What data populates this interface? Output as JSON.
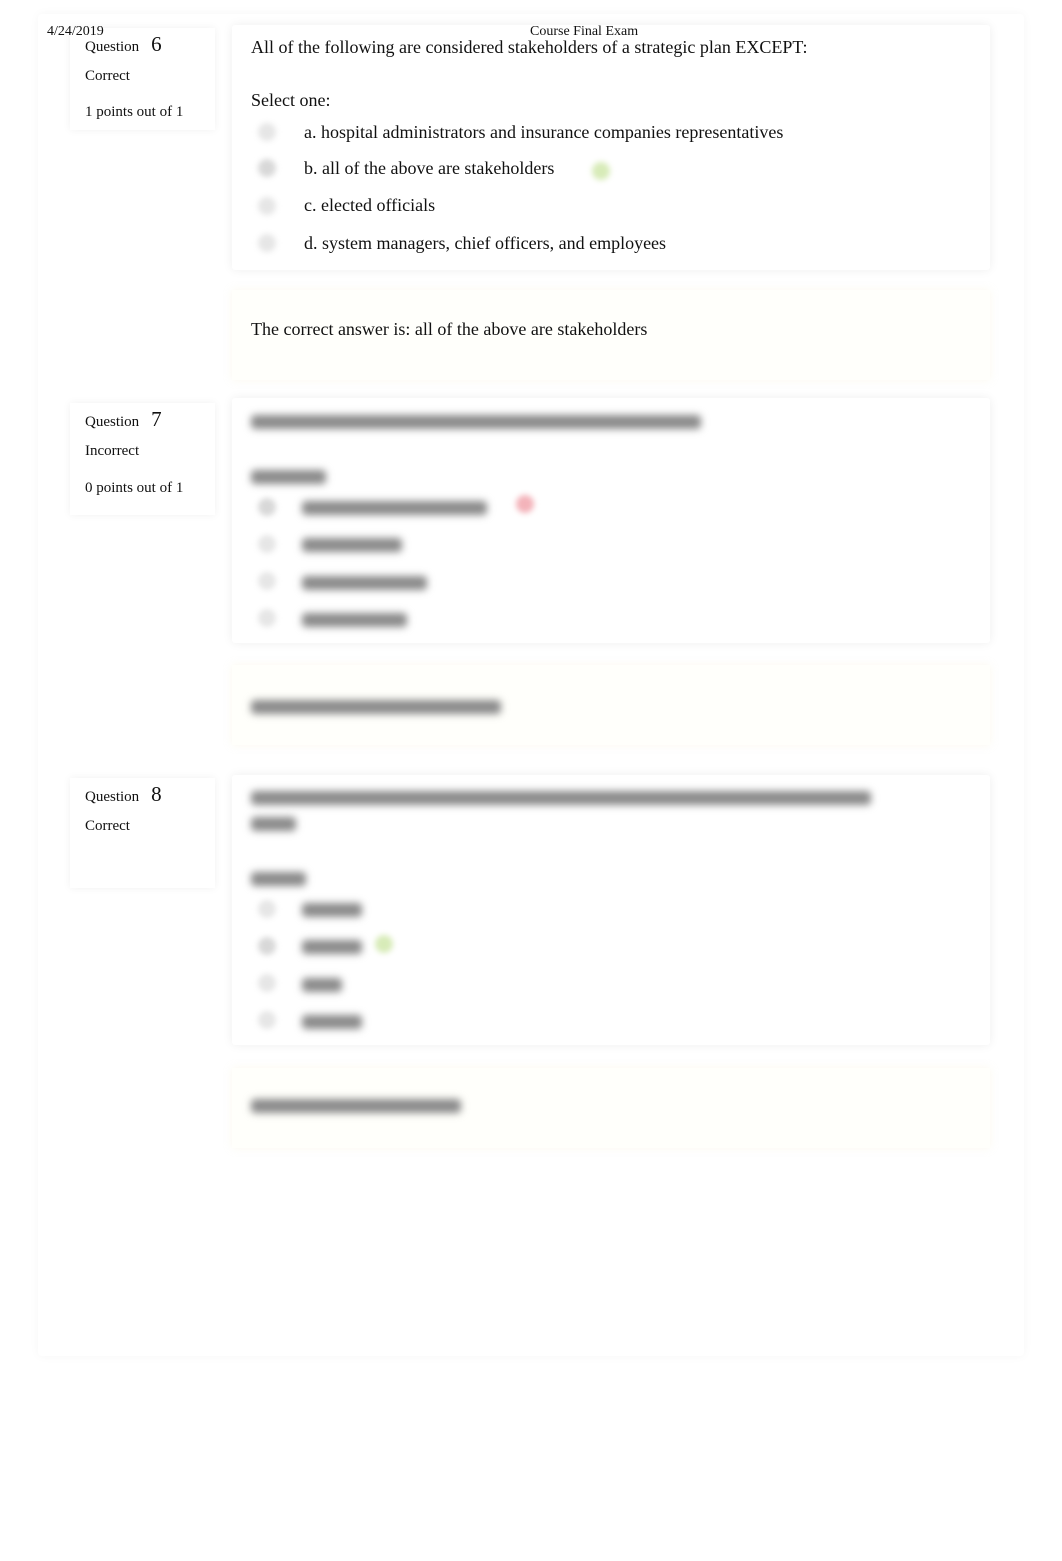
{
  "header": {
    "date": "4/24/2019",
    "title": "Course Final Exam"
  },
  "colors": {
    "correct_mark": "#c8e6a0",
    "incorrect_mark": "#f0a0a8"
  },
  "questions": [
    {
      "label": "Question",
      "number": "6",
      "status": "Correct",
      "points": "1 points out of 1",
      "text": "All of the following are considered stakeholders of a strategic plan EXCEPT:",
      "select": "Select one:",
      "options": [
        "a. hospital administrators and insurance companies representatives",
        "b. all of the above are stakeholders",
        "c. elected officials",
        "d. system managers, chief officers, and employees"
      ],
      "selected_index": 1,
      "mark": "check-icon",
      "feedback": "The correct answer is: all of the above are stakeholders"
    },
    {
      "label": "Question",
      "number": "7",
      "status": "Incorrect",
      "points": "0 points out of 1",
      "selected_index": 0,
      "mark": "cross-icon"
    },
    {
      "label": "Question",
      "number": "8",
      "status": "Correct",
      "selected_index": 1,
      "mark": "check-icon"
    }
  ]
}
